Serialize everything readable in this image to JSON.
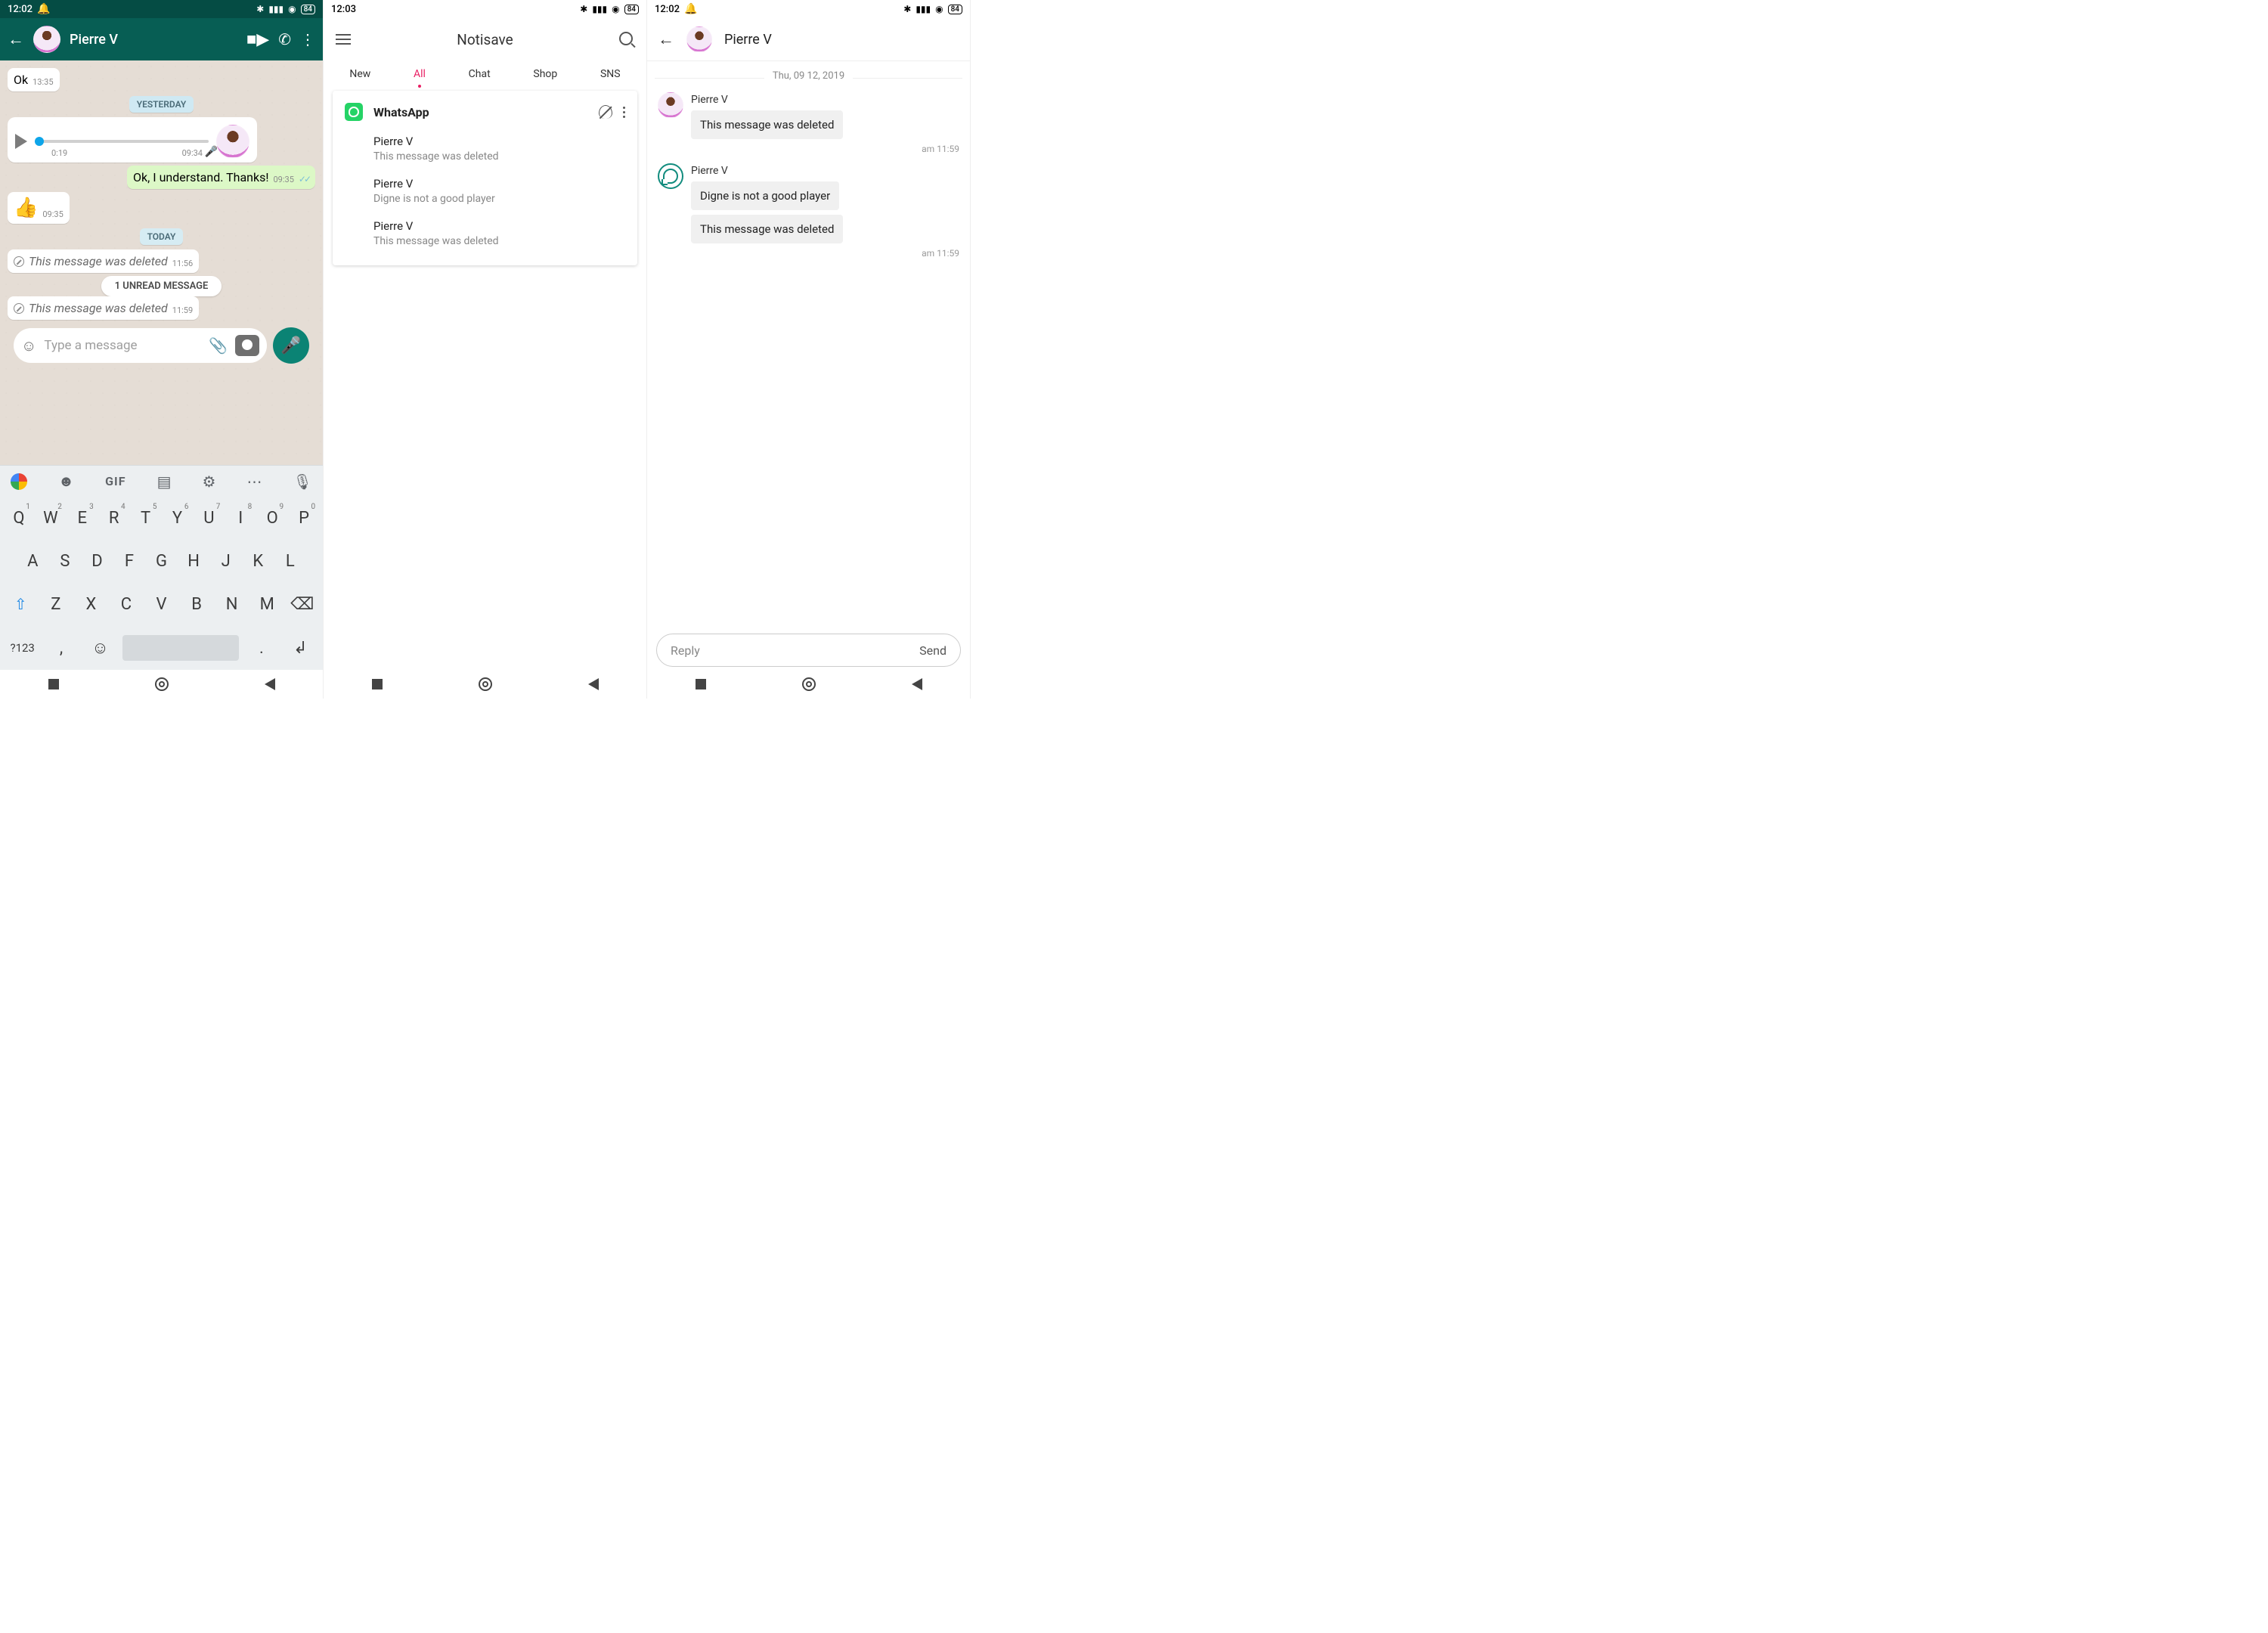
{
  "status": {
    "battery": "84"
  },
  "p1": {
    "time": "12:02",
    "contact": "Pierre V",
    "ok": "Ok",
    "ok_time": "13:35",
    "chip_yesterday": "YESTERDAY",
    "voice_dur": "0:19",
    "voice_time": "09:34",
    "out1": "Ok, I understand. Thanks!",
    "out1_time": "09:35",
    "thumb": "👍",
    "thumb_time": "09:35",
    "chip_today": "TODAY",
    "del1": "This message was deleted",
    "del1_time": "11:56",
    "unread": "1 UNREAD MESSAGE",
    "del2": "This message was deleted",
    "del2_time": "11:59",
    "input_placeholder": "Type a message",
    "kb_suggest": "GIF",
    "sym": "?123",
    "keys_r1": [
      "Q",
      "W",
      "E",
      "R",
      "T",
      "Y",
      "U",
      "I",
      "O",
      "P"
    ],
    "keys_r1_nums": [
      "1",
      "2",
      "3",
      "4",
      "5",
      "6",
      "7",
      "8",
      "9",
      "0"
    ],
    "keys_r2": [
      "A",
      "S",
      "D",
      "F",
      "G",
      "H",
      "J",
      "K",
      "L"
    ],
    "keys_r3": [
      "Z",
      "X",
      "C",
      "V",
      "B",
      "N",
      "M"
    ]
  },
  "p2": {
    "time": "12:03",
    "title": "Notisave",
    "tabs": [
      "New",
      "All",
      "Chat",
      "Shop",
      "SNS"
    ],
    "active_tab": "All",
    "app": "WhatsApp",
    "items": [
      {
        "from": "Pierre V",
        "body": "This message was deleted"
      },
      {
        "from": "Pierre V",
        "body": "Digne is not a good player"
      },
      {
        "from": "Pierre V",
        "body": "This message was deleted"
      }
    ]
  },
  "p3": {
    "time": "12:02",
    "contact": "Pierre V",
    "date": "Thu, 09 12, 2019",
    "g1_sender": "Pierre V",
    "g1_msg1": "This message was deleted",
    "g1_time": "am 11:59",
    "g2_sender": "Pierre V",
    "g2_msg1": "Digne is not a good player",
    "g2_msg2": "This message was deleted",
    "g2_time": "am 11:59",
    "reply_placeholder": "Reply",
    "send": "Send"
  }
}
